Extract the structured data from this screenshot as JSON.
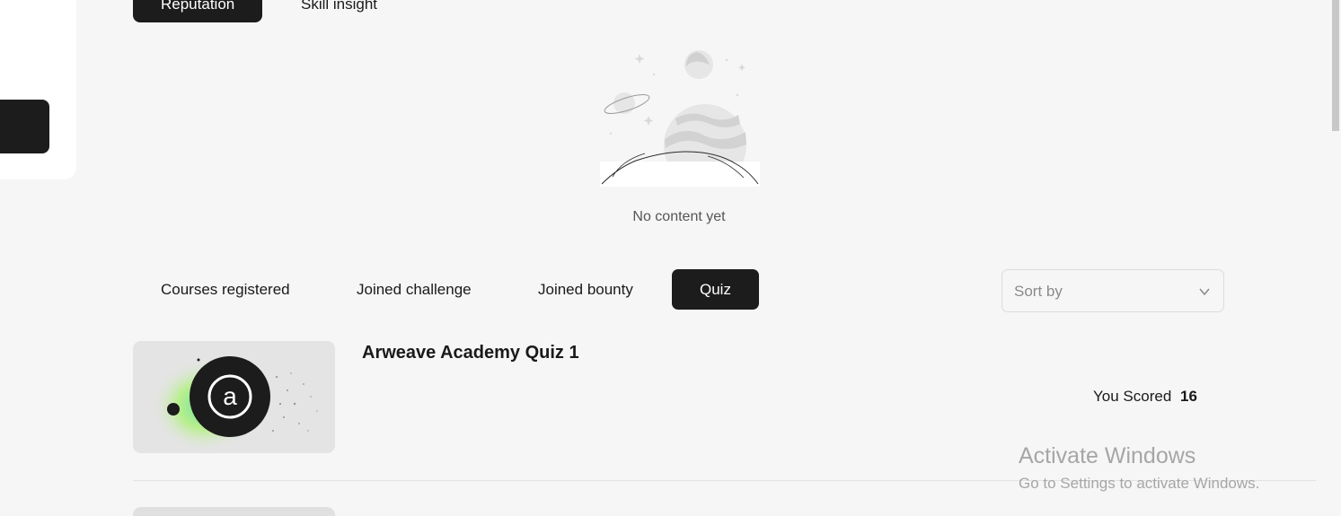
{
  "top_tabs": [
    {
      "label": "Reputation",
      "active": true
    },
    {
      "label": "Skill insight",
      "active": false
    }
  ],
  "empty_state": {
    "text": "No content yet",
    "icon": "empty-space-illustration"
  },
  "section_tabs": [
    {
      "label": "Courses registered",
      "active": false
    },
    {
      "label": "Joined challenge",
      "active": false
    },
    {
      "label": "Joined bounty",
      "active": false
    },
    {
      "label": "Quiz",
      "active": true
    }
  ],
  "sort": {
    "placeholder": "Sort by",
    "icon": "chevron-down-icon"
  },
  "quizzes": [
    {
      "title": "Arweave Academy Quiz 1",
      "score_label": "You Scored",
      "score": "16",
      "thumbnail_icon": "arweave-logo"
    }
  ],
  "watermark": {
    "title": "Activate Windows",
    "subtitle": "Go to Settings to activate Windows."
  },
  "colors": {
    "accent": "#1c1c1c",
    "background": "#f6f6f6"
  }
}
